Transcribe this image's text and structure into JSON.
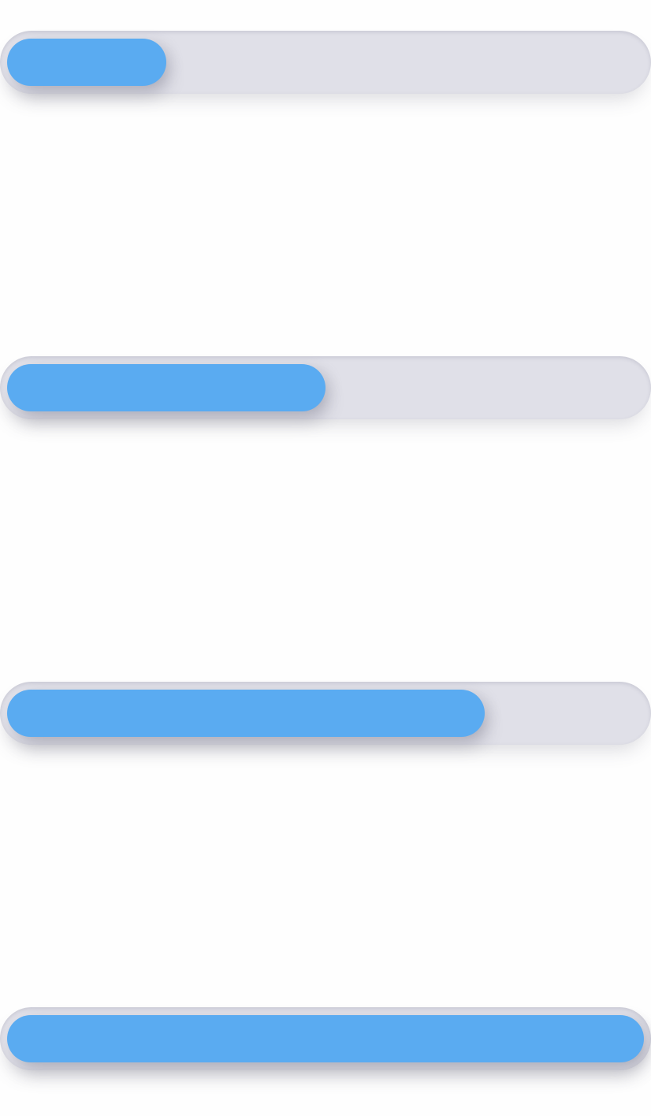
{
  "colors": {
    "background": "#fefefe",
    "track": "#e0e0e8",
    "fill": "#5aabf1"
  },
  "progress_bars": [
    {
      "name": "progress-bar-1",
      "progress": 0.25
    },
    {
      "name": "progress-bar-2",
      "progress": 0.5
    },
    {
      "name": "progress-bar-3",
      "progress": 0.75
    },
    {
      "name": "progress-bar-4",
      "progress": 1.0
    }
  ]
}
